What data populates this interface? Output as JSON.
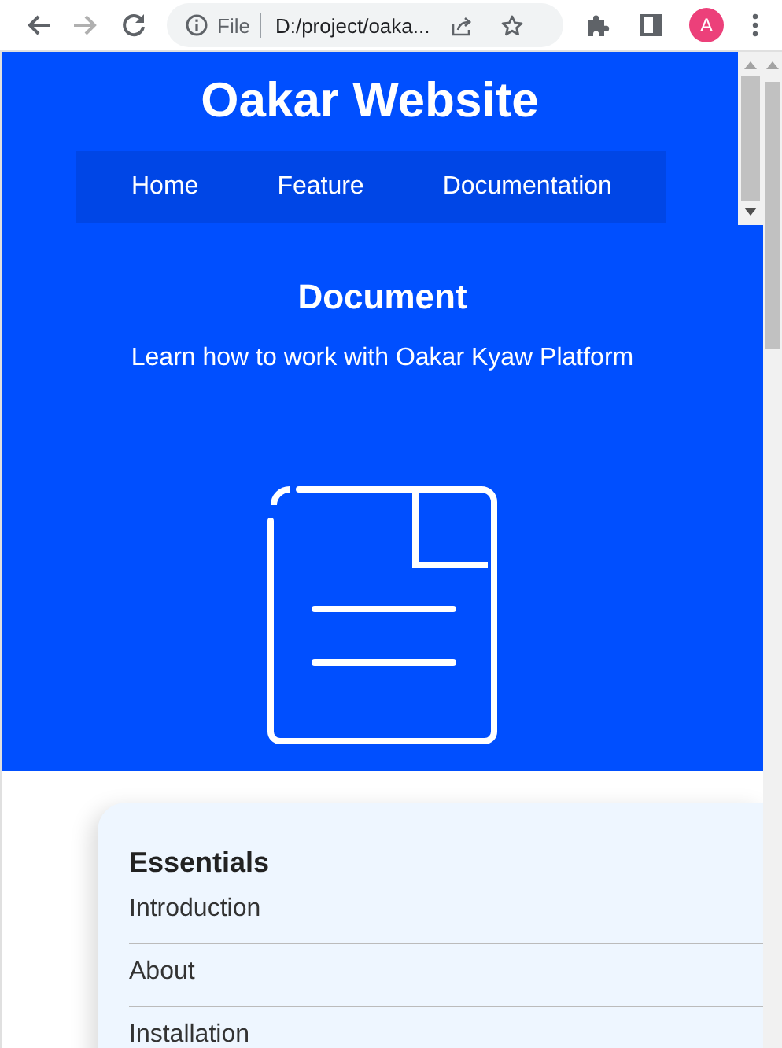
{
  "browser": {
    "nav_buttons": [
      {
        "kind": "back",
        "disabled": false
      },
      {
        "kind": "forward",
        "disabled": true
      },
      {
        "kind": "reload",
        "disabled": false
      }
    ],
    "address": {
      "scheme": "File",
      "url": "D:/project/oaka..."
    },
    "avatar": "A"
  },
  "site": {
    "title": "Oakar Website",
    "nav": [
      {
        "label": "Home"
      },
      {
        "label": "Feature"
      },
      {
        "label": "Documentation"
      }
    ],
    "hero": {
      "heading": "Document",
      "subtitle": "Learn how to work with Oakar Kyaw Platform"
    },
    "sidebar": {
      "heading": "Essentials",
      "items": [
        {
          "label": "Introduction"
        },
        {
          "label": "About"
        },
        {
          "label": "Installation"
        }
      ]
    }
  }
}
